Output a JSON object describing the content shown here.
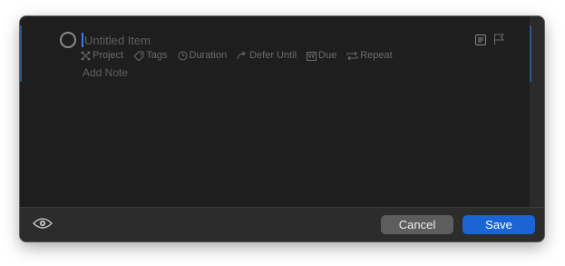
{
  "item": {
    "title_placeholder": "Untitled Item",
    "add_note": "Add Note"
  },
  "fields": [
    {
      "label": "Project",
      "icon": "project-icon"
    },
    {
      "label": "Tags",
      "icon": "tag-icon"
    },
    {
      "label": "Duration",
      "icon": "clock-icon"
    },
    {
      "label": "Defer Until",
      "icon": "defer-arrow-icon"
    },
    {
      "label": "Due",
      "icon": "calendar-icon"
    },
    {
      "label": "Repeat",
      "icon": "repeat-icon"
    }
  ],
  "toolbar": {
    "note_icon": "note-icon",
    "flag_icon": "flag-icon",
    "visibility_icon": "eye-icon"
  },
  "footer": {
    "cancel_label": "Cancel",
    "save_label": "Save"
  },
  "colors": {
    "accent": "#1a64d6",
    "caret": "#2f7cf6",
    "background": "#1e1e1e",
    "footer": "#2c2c2c"
  }
}
